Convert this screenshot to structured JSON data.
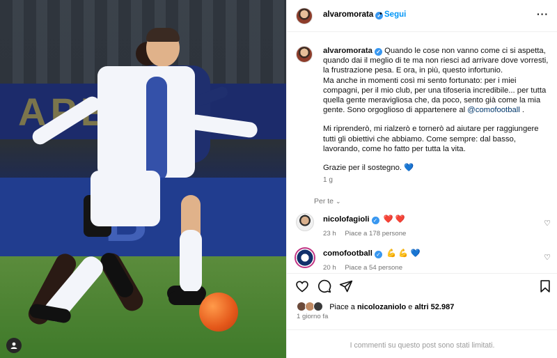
{
  "post": {
    "author": "alvaromorata",
    "follow_label": "Segui",
    "more_icon": "more-options-icon",
    "caption_paragraphs": [
      "Quando le cose non vanno come ci si aspetta, quando dai il meglio di te ma non riesci ad arrivare dove vorresti, la frustrazione pesa. E ora, in più, questo infortunio.",
      "Ma anche in momenti così mi sento fortunato: per i miei compagni, per il mio club, per una tifoseria incredibile... per tutta quella gente meravigliosa che, da poco, sento già come la mia gente. Sono orgoglioso di appartenere al",
      "Mi riprenderò, mi rialzerò e tornerò ad aiutare per raggiungere tutti gli obiettivi che abbiamo. Come sempre: dal basso, lavorando, come ho fatto per tutta la vita.",
      "Grazie per il sostegno. 💙"
    ],
    "caption_mention": "@comofootball",
    "caption_mention_suffix": " .",
    "caption_time": "1 g",
    "translate_label": "Per te"
  },
  "comments": [
    {
      "user": "nicolofagioli",
      "text": "❤️ ❤️",
      "time": "23 h",
      "likes": "Piace a 178 persone"
    },
    {
      "user": "comofootball",
      "text": "💪 💪 💙",
      "time": "20 h",
      "likes": "Piace a 54 persone"
    }
  ],
  "actions": {
    "liked_by_prefix": "Piace a ",
    "liked_by_user": "nicolozaniolo",
    "liked_by_mid": " e ",
    "liked_by_others": "altri 52.987",
    "posted_ago": "1 giorno fa",
    "comments_limited": "I commenti su questo post sono stati limitati."
  },
  "photo": {
    "board_text_top": "APE",
    "board_text_bottom": "B"
  },
  "colors": {
    "link": "#0095f6",
    "mention": "#00376b",
    "verified": "#3897f0",
    "muted": "#737373",
    "heart_red": "#ed4956"
  }
}
